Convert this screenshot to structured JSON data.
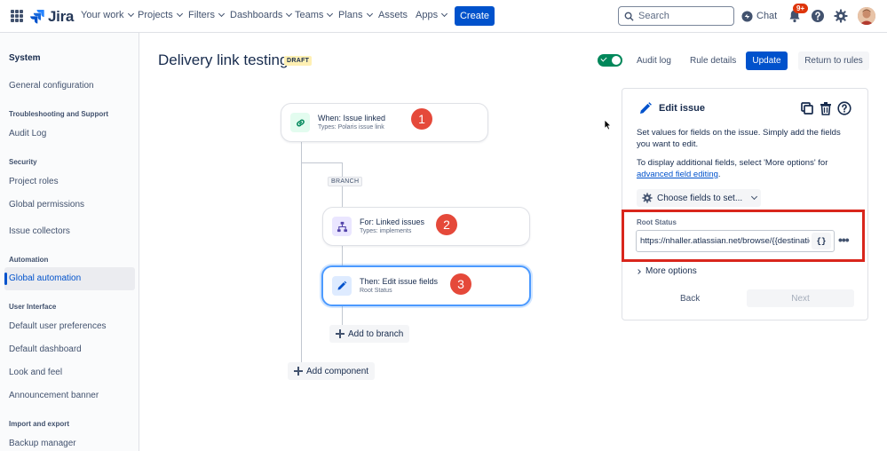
{
  "topnav": {
    "logo": "Jira",
    "items": [
      {
        "label": "Your work"
      },
      {
        "label": "Projects"
      },
      {
        "label": "Filters"
      },
      {
        "label": "Dashboards"
      },
      {
        "label": "Teams"
      },
      {
        "label": "Plans"
      },
      {
        "label": "Assets"
      },
      {
        "label": "Apps"
      }
    ],
    "create_label": "Create",
    "search_placeholder": "Search",
    "chat_label": "Chat",
    "notifications_badge": "9+",
    "icons": [
      "apps-grid-icon",
      "search-icon",
      "chat-icon",
      "bell-icon",
      "help-icon",
      "gear-icon",
      "avatar"
    ]
  },
  "sidebar": {
    "title": "System",
    "general": "General configuration",
    "sections": [
      {
        "label": "Troubleshooting and Support",
        "items": [
          "Audit Log"
        ]
      },
      {
        "label": "Security",
        "items": [
          "Project roles",
          "Global permissions",
          "Issue collectors"
        ]
      },
      {
        "label": "Automation",
        "items": [
          "Global automation"
        ]
      },
      {
        "label": "User Interface",
        "items": [
          "Default user preferences",
          "Default dashboard",
          "Look and feel",
          "Announcement banner"
        ]
      },
      {
        "label": "Import and export",
        "items": [
          "Backup manager"
        ]
      }
    ],
    "active_item": "Global automation"
  },
  "header": {
    "title": "Delivery link testing",
    "status_badge": "DRAFT",
    "audit_log": "Audit log",
    "rule_details": "Rule details",
    "update": "Update",
    "return": "Return to rules",
    "enabled": true
  },
  "rule": {
    "trigger": {
      "title": "When: Issue linked",
      "subtitle": "Types: Polaris issue link",
      "number": "1"
    },
    "branch_tag": "BRANCH",
    "branch": {
      "title": "For: Linked issues",
      "subtitle": "Types: implements",
      "number": "2"
    },
    "action": {
      "title": "Then: Edit issue fields",
      "subtitle": "Root Status",
      "number": "3"
    },
    "add_to_branch": "Add to branch",
    "add_component": "Add component"
  },
  "panel": {
    "title": "Edit issue",
    "desc_line1": "Set values for fields on the issue. Simply add the fields",
    "desc_line2": "you want to edit.",
    "info_line1": "To display additional fields, select 'More options' for",
    "info_link": "advanced field editing",
    "info_end": ".",
    "choose_fields": "Choose fields to set...",
    "field_label": "Root Status",
    "field_value": "https://nhaller.atlassian.net/browse/{{destinationIssue.key}}",
    "braces": "{}",
    "more_options": "More options",
    "back": "Back",
    "next": "Next"
  },
  "colors": {
    "brand_blue": "#0052CC",
    "toggle_green": "#00875A",
    "annotation_red": "#D9261C",
    "badge_red": "#E5493A"
  }
}
